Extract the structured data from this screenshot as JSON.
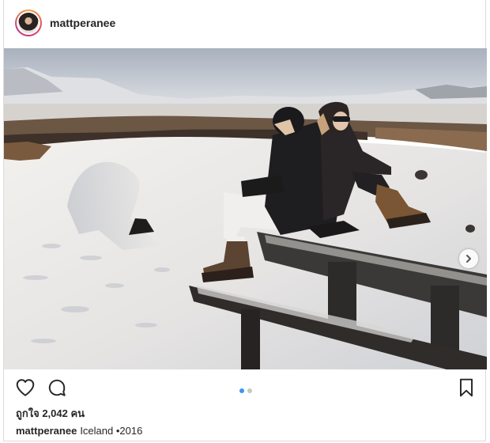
{
  "post": {
    "username": "mattperanee",
    "likes_text": "ถูกใจ 2,042 คน",
    "caption": {
      "username": "mattperanee",
      "text": "Iceland •2016"
    },
    "carousel": {
      "count": 2,
      "active_index": 0
    }
  },
  "icons": {
    "like": "heart-icon",
    "comment": "comment-bubble-icon",
    "save": "bookmark-icon",
    "next": "chevron-right-icon"
  },
  "colors": {
    "text": "#262626",
    "border": "#dbdbdb",
    "dot_active": "#3897f0",
    "dot_inactive": "#c7c7c7"
  }
}
